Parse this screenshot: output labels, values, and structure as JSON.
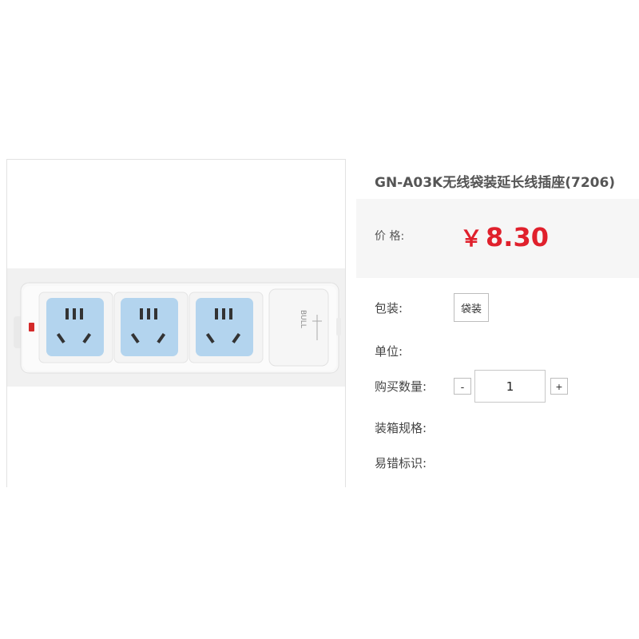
{
  "product": {
    "title": "GN-A03K无线袋装延长线插座(7206)",
    "image_alt": "GN-A03K power strip",
    "image_brand_text": "BULL"
  },
  "price": {
    "label": "价 格:",
    "currency": "￥",
    "amount": "8.30",
    "color": "#e0202c"
  },
  "packaging": {
    "label": "包装:",
    "selected": "袋装"
  },
  "unit": {
    "label": "单位:",
    "value": ""
  },
  "quantity": {
    "label": "购买数量:",
    "minus": "-",
    "value": "1",
    "plus": "+"
  },
  "box_spec": {
    "label": "装箱规格:",
    "value": ""
  },
  "error_mark": {
    "label": "易错标识:",
    "value": ""
  },
  "colors": {
    "socket_blue": "#b3d4ee",
    "price_bg": "#f6f6f6"
  }
}
